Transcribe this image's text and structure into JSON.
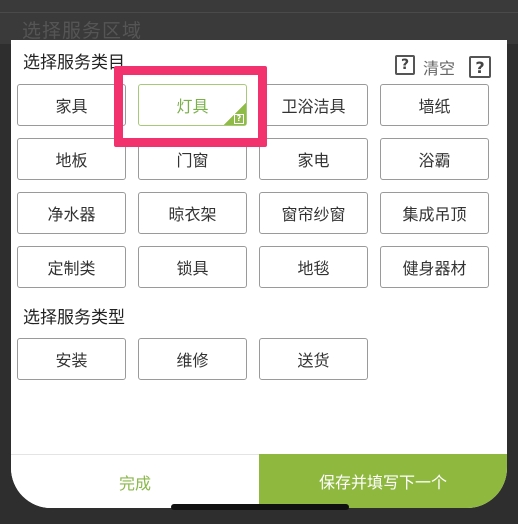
{
  "background": {
    "title": "选择服务区域"
  },
  "header": {
    "title": "选择服务类目",
    "clear_label": "清空",
    "help_glyph": "?"
  },
  "categories": [
    [
      "家具",
      "灯具",
      "卫浴洁具",
      "墙纸"
    ],
    [
      "地板",
      "门窗",
      "家电",
      "浴霸"
    ],
    [
      "净水器",
      "晾衣架",
      "窗帘纱窗",
      "集成吊顶"
    ],
    [
      "定制类",
      "锁具",
      "地毯",
      "健身器材"
    ]
  ],
  "selected_category": "灯具",
  "service_type": {
    "title": "选择服务类型",
    "options": [
      "安装",
      "维修",
      "送货"
    ]
  },
  "footer": {
    "done_label": "完成",
    "next_label": "保存并填写下一个"
  },
  "colors": {
    "accent": "#8fb83f",
    "highlight": "#f2326f"
  }
}
